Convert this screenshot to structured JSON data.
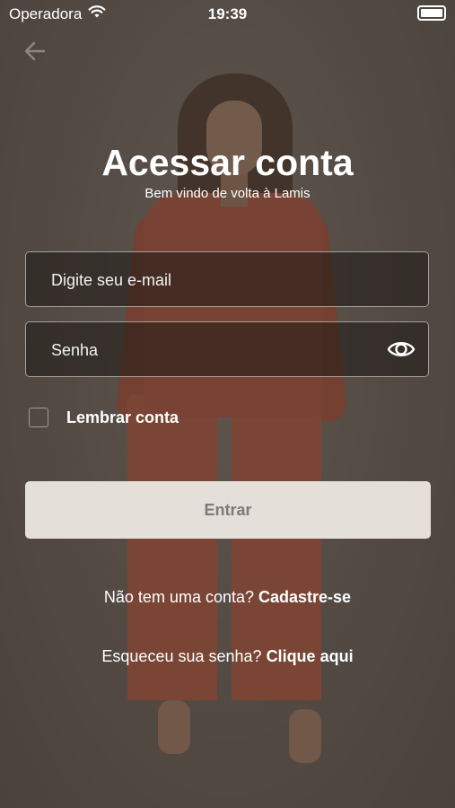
{
  "status_bar": {
    "carrier": "Operadora",
    "time": "19:39",
    "icons": [
      "wifi-icon",
      "battery-icon"
    ]
  },
  "header": {
    "back_icon": "arrow-left-icon"
  },
  "login": {
    "title": "Acessar conta",
    "subtitle": "Bem vindo de volta à Lamis",
    "email": {
      "value": "",
      "placeholder": "Digite seu e-mail"
    },
    "password": {
      "value": "",
      "placeholder": "Senha",
      "toggle_icon": "eye-icon"
    },
    "remember": {
      "label": "Lembrar conta",
      "checked": false
    },
    "submit_label": "Entrar",
    "signup": {
      "prompt": "Não tem uma conta?",
      "link": "Cadastre-se"
    },
    "forgot": {
      "prompt": "Esqueceu sua senha?",
      "link": "Clique aqui"
    }
  },
  "colors": {
    "overlay": "#3c342f",
    "button_bg": "#e4dfd9",
    "button_text": "#7e7975",
    "outfit": "#c85a3d"
  }
}
